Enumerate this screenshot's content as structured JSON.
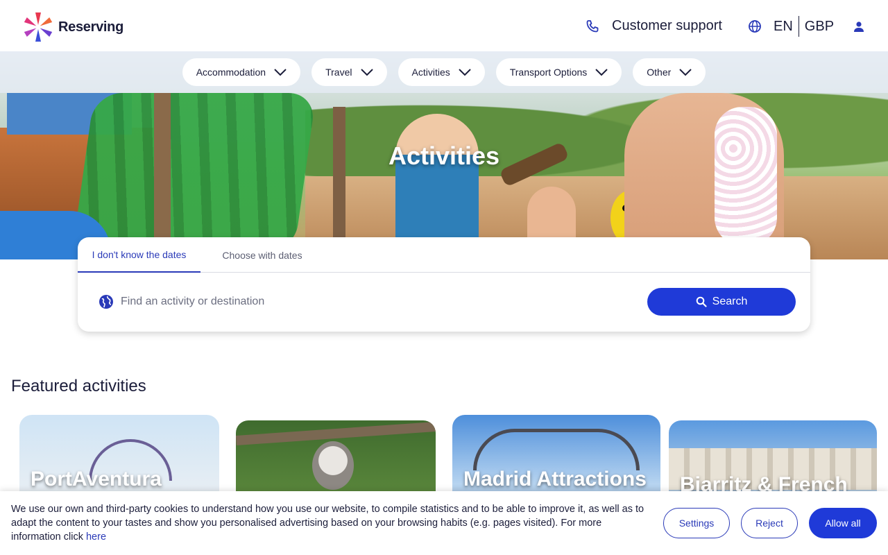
{
  "header": {
    "brand": "Reserving",
    "support_label": "Customer support",
    "language": "EN",
    "currency": "GBP",
    "icons": {
      "support": "phone-icon",
      "language": "globe-icon",
      "account": "user-icon"
    }
  },
  "nav": {
    "items": [
      {
        "label": "Accommodation"
      },
      {
        "label": "Travel"
      },
      {
        "label": "Activities"
      },
      {
        "label": "Transport Options"
      },
      {
        "label": "Other"
      }
    ]
  },
  "hero": {
    "title": "Activities"
  },
  "search": {
    "tabs": [
      {
        "label": "I don't know the dates",
        "active": true
      },
      {
        "label": "Choose with dates",
        "active": false
      }
    ],
    "placeholder": "Find an activity or destination",
    "button_label": "Search"
  },
  "featured": {
    "title": "Featured activities",
    "cards": [
      {
        "label": "PortAventura"
      },
      {
        "label": ""
      },
      {
        "label": "Madrid Attractions"
      },
      {
        "label": "Biarritz & French"
      }
    ]
  },
  "cookie": {
    "text": "We use our own and third-party cookies to understand how you use our website, to compile statistics and to be able to improve it, as well as to adapt the content to your tastes and show you personalised advertising based on your browsing habits (e.g. pages visited). For more information click ",
    "link": "here",
    "settings_label": "Settings",
    "reject_label": "Reject",
    "allow_label": "Allow all"
  },
  "colors": {
    "primary": "#1f3ad8",
    "text": "#1b1d3a",
    "link": "#2a3ab8"
  }
}
